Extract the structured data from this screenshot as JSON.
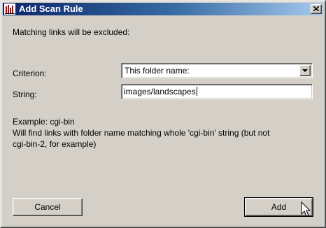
{
  "window": {
    "title": "Add Scan Rule",
    "close_glyph": "×",
    "icon": "bar-chart-app-icon"
  },
  "dialog": {
    "intro": "Matching links will be excluded:",
    "criterion_label": "Criterion:",
    "criterion_value": "This folder name:",
    "string_label": "String:",
    "string_value": "images/landscapes",
    "example_line1": "Example: cgi-bin",
    "example_line2": "Will find links with folder name matching whole 'cgi-bin' string (but not",
    "example_line3": "cgi-bin-2, for example)"
  },
  "buttons": {
    "cancel": "Cancel",
    "add": "Add"
  },
  "colors": {
    "face": "#d4d0c8",
    "title_gradient_start": "#0a246a",
    "title_gradient_end": "#a6caf0"
  }
}
